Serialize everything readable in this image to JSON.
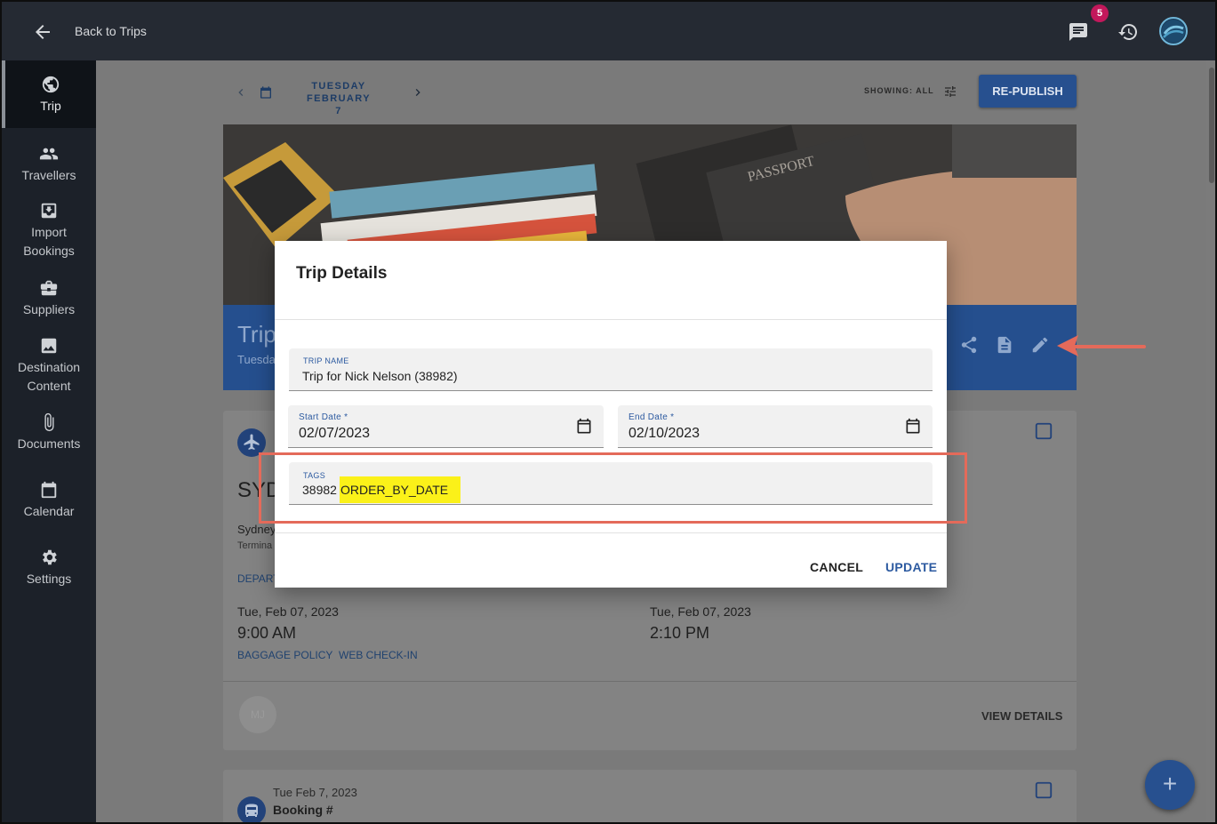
{
  "topbar": {
    "back_label": "Back to Trips",
    "notification_count": "5"
  },
  "sidebar": {
    "items": [
      {
        "label": "Trip",
        "icon": "globe-icon",
        "active": true
      },
      {
        "label": "Travellers",
        "icon": "people-icon"
      },
      {
        "label": "Import Bookings",
        "icon": "import-icon"
      },
      {
        "label": "Suppliers",
        "icon": "briefcase-icon"
      },
      {
        "label": "Destination Content",
        "icon": "image-icon"
      },
      {
        "label": "Documents",
        "icon": "paperclip-icon"
      },
      {
        "label": "Calendar",
        "icon": "calendar-icon"
      },
      {
        "label": "Settings",
        "icon": "gear-icon"
      }
    ]
  },
  "date_nav": {
    "day": "TUESDAY",
    "date": "FEBRUARY 7",
    "showing": "SHOWING: ALL",
    "republish": "RE-PUBLISH"
  },
  "hero": {
    "title": "Trip",
    "subtitle": "Tuesda"
  },
  "card": {
    "code": "SYD",
    "city": "Sydney",
    "terminal": "Termina",
    "depart_link": "DEPART",
    "dep_date": "Tue, Feb 07, 2023",
    "dep_time": "9:00 AM",
    "arr_date": "Tue, Feb 07, 2023",
    "arr_time": "2:10 PM",
    "baggage": "BAGGAGE POLICY",
    "checkin": "WEB CHECK-IN",
    "initials": "MJ",
    "view_details": "VIEW DETAILS"
  },
  "card2": {
    "date": "Tue Feb 7, 2023",
    "booking": "Booking #"
  },
  "modal": {
    "title": "Trip Details",
    "trip_name_label": "TRIP NAME",
    "trip_name": "Trip for Nick Nelson (38982)",
    "start_label": "Start Date *",
    "start_date": "02/07/2023",
    "end_label": "End Date *",
    "end_date": "02/10/2023",
    "tags_label": "TAGS",
    "tags": [
      "38982",
      "ORDER_BY_DATE"
    ],
    "cancel": "CANCEL",
    "update": "UPDATE"
  },
  "colors": {
    "primary": "#2c5aa0",
    "highlight": "#fbf119",
    "annotation": "#e46a5a",
    "badge": "#c2185b"
  }
}
